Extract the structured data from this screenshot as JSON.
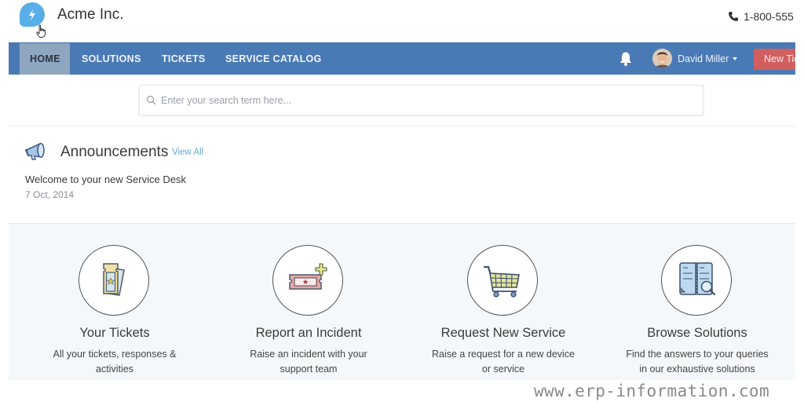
{
  "header": {
    "brand": "Acme Inc.",
    "logo_icon": "lightning-bolt-icon",
    "phone_icon": "phone-icon",
    "phone": "1-800-555"
  },
  "nav": {
    "items": [
      {
        "label": "HOME",
        "active": true
      },
      {
        "label": "SOLUTIONS",
        "active": false
      },
      {
        "label": "TICKETS",
        "active": false
      },
      {
        "label": "SERVICE CATALOG",
        "active": false
      }
    ],
    "notification_icon": "bell-icon",
    "user_name": "David Miller",
    "new_ticket_label": "New Ticket"
  },
  "search": {
    "placeholder": "Enter your search term here...",
    "value": ""
  },
  "announcements": {
    "title": "Announcements",
    "view_all": "View All",
    "items": [
      {
        "message": "Welcome to your new Service Desk",
        "date": "7 Oct, 2014"
      }
    ]
  },
  "tiles": [
    {
      "title": "Your Tickets",
      "description": "All your tickets, responses & activities",
      "icon": "tickets-icon"
    },
    {
      "title": "Report an Incident",
      "description": "Raise an incident with your support team",
      "icon": "add-ticket-icon"
    },
    {
      "title": "Request New Service",
      "description": "Raise a request for a new device or service",
      "icon": "shopping-cart-icon"
    },
    {
      "title": "Browse Solutions",
      "description": "Find the answers to your queries in our exhaustive solutions",
      "icon": "book-search-icon"
    }
  ],
  "colors": {
    "nav_bg": "#4a7ab5",
    "nav_active_bg": "#8fa6c1",
    "new_ticket_bg": "#d15f5f",
    "logo": "#5aaee8",
    "link": "#6aa5d8",
    "tiles_bg": "#f5f8fb"
  },
  "watermark": "www.erp-information.com"
}
